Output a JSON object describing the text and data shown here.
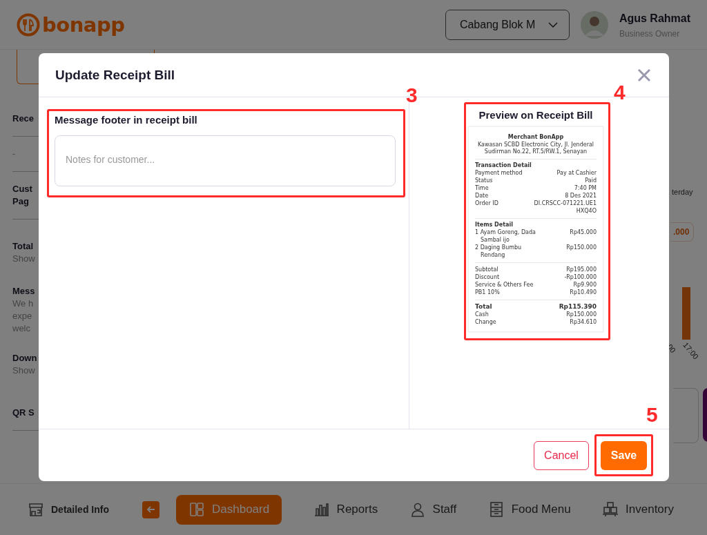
{
  "header": {
    "logo": "bonapp",
    "branch": "Cabang Blok M",
    "user": {
      "name": "Agus Rahmat",
      "role": "Business Owner"
    }
  },
  "background": {
    "left_sections": [
      {
        "title": [
          "Rece"
        ],
        "divider": true
      },
      {
        "body": [
          "-"
        ],
        "divider": true
      },
      {
        "title": [
          "Cust",
          "Pag"
        ],
        "divider": true
      },
      {
        "title": [
          "Total"
        ],
        "body": [
          "Show"
        ],
        "divider": false
      },
      {
        "title": [
          "Mess"
        ],
        "body": [
          "We h",
          "expe",
          "welc"
        ],
        "divider": false
      },
      {
        "title": [
          "Down"
        ],
        "body": [
          "Show"
        ],
        "divider": false
      },
      {
        "title": [
          "QR S"
        ],
        "divider": true
      }
    ],
    "right": {
      "period": "terday",
      "amount": ".000",
      "axis_labels": [
        "00",
        "17:00"
      ]
    }
  },
  "modal": {
    "title": "Update Receipt Bill",
    "footer_field": {
      "label": "Message footer in receipt bill",
      "placeholder": "Notes for customer..."
    },
    "preview": {
      "title": "Preview on Receipt Bill",
      "receipt": {
        "merchant": "Merchant BonApp",
        "address": "Kawasan SCBD Electronic City, Jl. Jenderal Sudirman No.22, RT.5/RW.1, Senayan",
        "sections": [
          {
            "title": "Transaction Detail",
            "rows": [
              {
                "label": "Payment method",
                "value": "Pay at Cashier",
                "kind": "normal"
              },
              {
                "label": "Status",
                "value": "Paid",
                "kind": "normal"
              },
              {
                "label": "Time",
                "value": "7:40 PM",
                "kind": "normal"
              },
              {
                "label": "Date",
                "value": "8 Des 2021",
                "kind": "normal"
              },
              {
                "label": "Order ID",
                "value": "DI.CRSCC-071221.UE1 HXQ4O",
                "kind": "normal"
              }
            ]
          },
          {
            "title": "Items Detail",
            "rows": [
              {
                "label": "1 Ayam Goreng, Dada Sambal ijo",
                "value": "Rp45.000",
                "kind": "item"
              },
              {
                "label": "2 Daging Bumbu Rendang",
                "value": "Rp150.000",
                "kind": "item"
              }
            ]
          },
          {
            "rows": [
              {
                "label": "Subtotal",
                "value": "Rp195.000",
                "kind": "normal"
              },
              {
                "label": "Discount",
                "value": "-Rp100.000",
                "kind": "normal"
              },
              {
                "label": "Service & Others Fee",
                "value": "Rp9.900",
                "kind": "normal"
              },
              {
                "label": "PB1 10%",
                "value": "Rp10.490",
                "kind": "normal"
              }
            ]
          },
          {
            "rows": [
              {
                "label": "Total",
                "value": "Rp115.390",
                "kind": "total"
              },
              {
                "label": "Cash",
                "value": "Rp150.000",
                "kind": "normal"
              },
              {
                "label": "Change",
                "value": "Rp34.610",
                "kind": "normal"
              }
            ]
          }
        ]
      }
    },
    "buttons": {
      "cancel": "Cancel",
      "save": "Save"
    }
  },
  "annotations": [
    {
      "number": "3"
    },
    {
      "number": "4"
    },
    {
      "number": "5"
    }
  ],
  "side_tab": {
    "label": "Detailed Info"
  },
  "nav": [
    {
      "label": "Dashboard",
      "selected": true
    },
    {
      "label": "Reports",
      "selected": false
    },
    {
      "label": "Staff",
      "selected": false
    },
    {
      "label": "Food Menu",
      "selected": false
    },
    {
      "label": "Inventory",
      "selected": false
    }
  ]
}
